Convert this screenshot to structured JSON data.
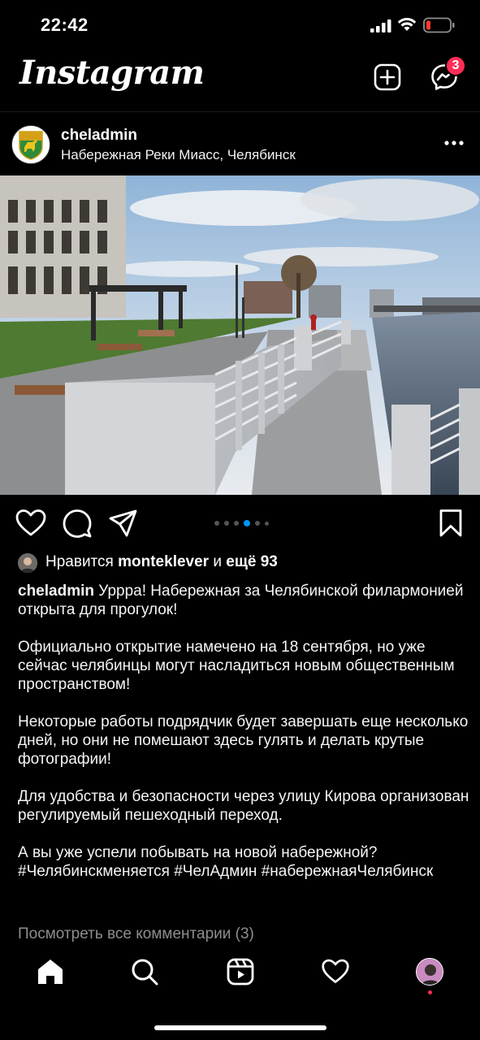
{
  "status_bar": {
    "time": "22:42",
    "icons": [
      "cellular-signal-icon",
      "wifi-icon",
      "battery-low-icon"
    ]
  },
  "header": {
    "logo": "Instagram",
    "icons": [
      "new-post-icon",
      "messenger-icon"
    ],
    "messages_badge": "3"
  },
  "post": {
    "username": "cheladmin",
    "location": "Набережная Реки Миасс, Челябинск",
    "carousel": {
      "total": 6,
      "active_index": 3
    },
    "likes": {
      "prefix": "Нравится",
      "user": "monteklever",
      "conjunction": "и",
      "others": "ещё 93"
    },
    "caption": {
      "username": "cheladmin",
      "paragraphs": [
        "Урррa! Набережная за Челябинской филармонией открыта для прогулок!",
        "Официально открытие намечено на 18 сентября, но уже сейчас челябинцы могут насладиться новым общественным пространством!",
        "Некоторые работы подрядчик будет завершать еще несколько дней, но они не помешают здесь гулять и делать крутые фотографии!",
        "Для удобства и безопасности через улицу Кирова организован регулируемый пешеходный переход.",
        "А вы уже успели побывать на новой набережной? #Челябинскменяется #ЧелАдмин #набережнаяЧелябинск"
      ]
    },
    "comments_link": "Посмотреть все комментарии (3)"
  },
  "bottom_nav": {
    "items": [
      "home-icon",
      "search-icon",
      "reels-icon",
      "activity-heart-icon",
      "profile-avatar"
    ]
  },
  "colors": {
    "background": "#000000",
    "accent": "#0095f6",
    "badge": "#ff2d55",
    "muted_text": "#8e8e8e"
  }
}
